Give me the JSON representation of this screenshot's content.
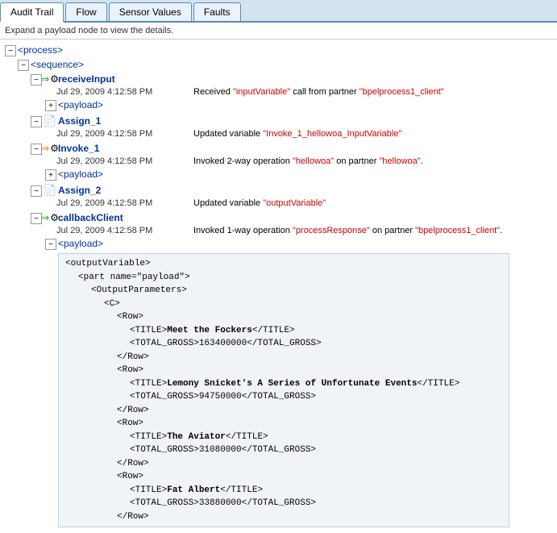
{
  "tabs": [
    {
      "label": "Audit Trail",
      "active": true
    },
    {
      "label": "Flow",
      "active": false
    },
    {
      "label": "Sensor Values",
      "active": false
    },
    {
      "label": "Faults",
      "active": false
    }
  ],
  "info_bar": "Expand a payload node to view the details.",
  "tree": {
    "process_label": "<process>",
    "sequence_label": "<sequence>",
    "nodes": [
      {
        "id": "receiveInput",
        "label": "receiveInput",
        "type": "gear-green",
        "events": [
          {
            "time": "Jul 29, 2009 4:12:58 PM",
            "desc": "Received \"inputVariable\" call from partner \"bpelprocess1_client\""
          }
        ],
        "payload_label": "<payload>"
      },
      {
        "id": "Assign_1",
        "label": "Assign_1",
        "type": "doc",
        "events": [
          {
            "time": "Jul 29, 2009 4:12:58 PM",
            "desc": "Updated variable \"Invoke_1_hellowoa_InputVariable\""
          }
        ]
      },
      {
        "id": "Invoke_1",
        "label": "Invoke_1",
        "type": "gear-orange",
        "events": [
          {
            "time": "Jul 29, 2009 4:12:58 PM",
            "desc": "Invoked 2-way operation \"hellowoa\" on partner \"hellowoa\"."
          }
        ],
        "payload_label": "<payload>"
      },
      {
        "id": "Assign_2",
        "label": "Assign_2",
        "type": "doc",
        "events": [
          {
            "time": "Jul 29, 2009 4:12:58 PM",
            "desc": "Updated variable \"outputVariable\""
          }
        ]
      },
      {
        "id": "callbackClient",
        "label": "callbackClient",
        "type": "gear-green",
        "events": [
          {
            "time": "Jul 29, 2009 4:12:58 PM",
            "desc": "Invoked 1-way operation \"processResponse\" on partner \"bpelprocess1_client\"."
          }
        ],
        "payload_expanded": true,
        "payload_label": "<payload>",
        "xml_lines": [
          {
            "indent": 0,
            "text": "<outputVariable>"
          },
          {
            "indent": 1,
            "text": "<part name=\"payload\">"
          },
          {
            "indent": 2,
            "text": "<OutputParameters>"
          },
          {
            "indent": 3,
            "text": "<C>"
          },
          {
            "indent": 4,
            "text": "<Row>"
          },
          {
            "indent": 5,
            "text": "<TITLE>",
            "bold_content": "Meet the Fockers",
            "suffix": "</TITLE>"
          },
          {
            "indent": 5,
            "text": "<TOTAL_GROSS>163400000</TOTAL_GROSS>"
          },
          {
            "indent": 4,
            "text": "</Row>"
          },
          {
            "indent": 4,
            "text": "<Row>"
          },
          {
            "indent": 5,
            "text": "<TITLE>",
            "bold_content": "Lemony Snicket's A Series of Unfortunate Events",
            "suffix": "</TITLE>"
          },
          {
            "indent": 5,
            "text": "<TOTAL_GROSS>94750000</TOTAL_GROSS>"
          },
          {
            "indent": 4,
            "text": "</Row>"
          },
          {
            "indent": 4,
            "text": "<Row>"
          },
          {
            "indent": 5,
            "text": "<TITLE>",
            "bold_content": "The Aviator",
            "suffix": "</TITLE>"
          },
          {
            "indent": 5,
            "text": "<TOTAL_GROSS>31080000</TOTAL_GROSS>"
          },
          {
            "indent": 4,
            "text": "</Row>"
          },
          {
            "indent": 4,
            "text": "<Row>"
          },
          {
            "indent": 5,
            "text": "<TITLE>",
            "bold_content": "Fat Albert",
            "suffix": "</TITLE>"
          },
          {
            "indent": 5,
            "text": "<TOTAL_GROSS>33880000</TOTAL_GROSS>"
          },
          {
            "indent": 4,
            "text": "</Row>"
          }
        ]
      }
    ]
  }
}
